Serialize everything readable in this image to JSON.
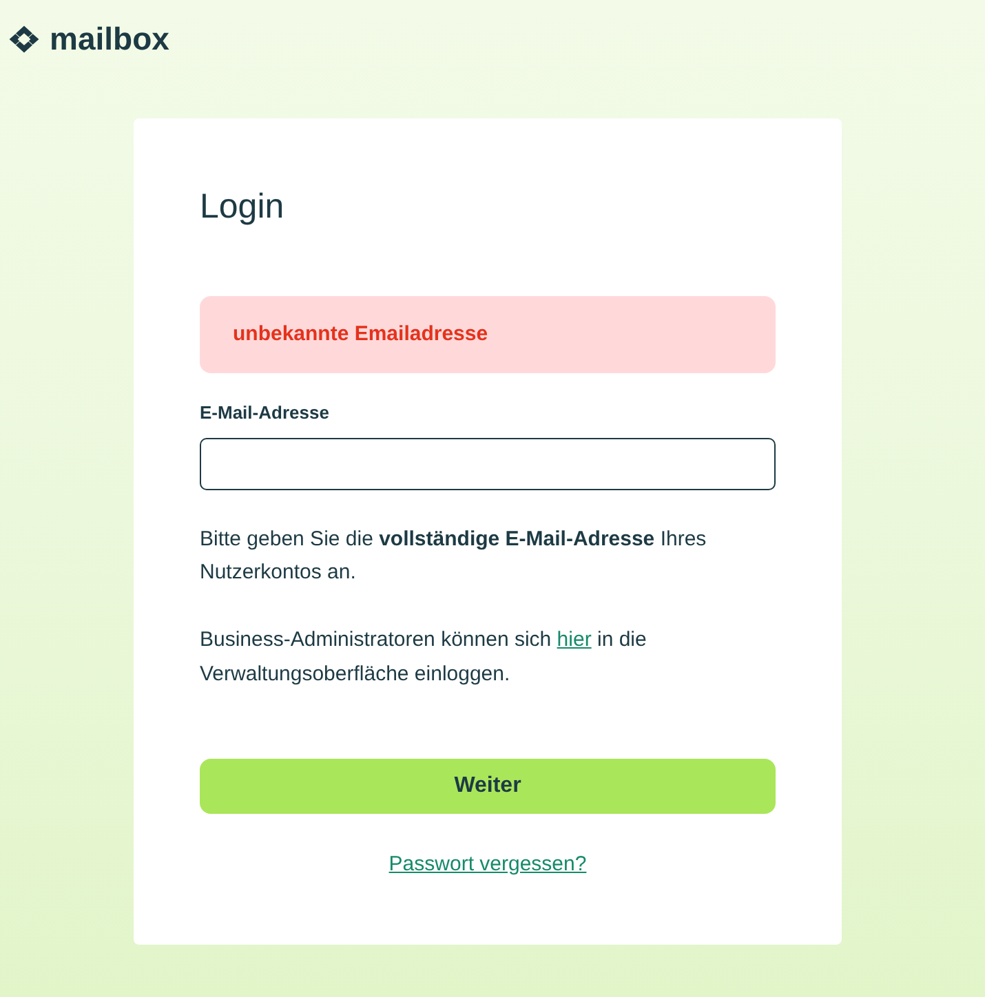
{
  "header": {
    "logo_text": "mailbox"
  },
  "login": {
    "title": "Login",
    "error": "unbekannte Emailadresse",
    "email_field": {
      "label": "E-Mail-Adresse"
    },
    "hint": "Bitte geben Sie die **vollständige E-Mail-Adresse** Ihres Nutzerkontos an.",
    "admin_note": {
      "text_before": "Business-Administratoren können sich",
      "link": "hier",
      "text_after": "in die Verwaltungsoberfläche einloggen."
    },
    "submit_button": "Weiter",
    "forgot_link": "Passwort vergessen?"
  }
}
